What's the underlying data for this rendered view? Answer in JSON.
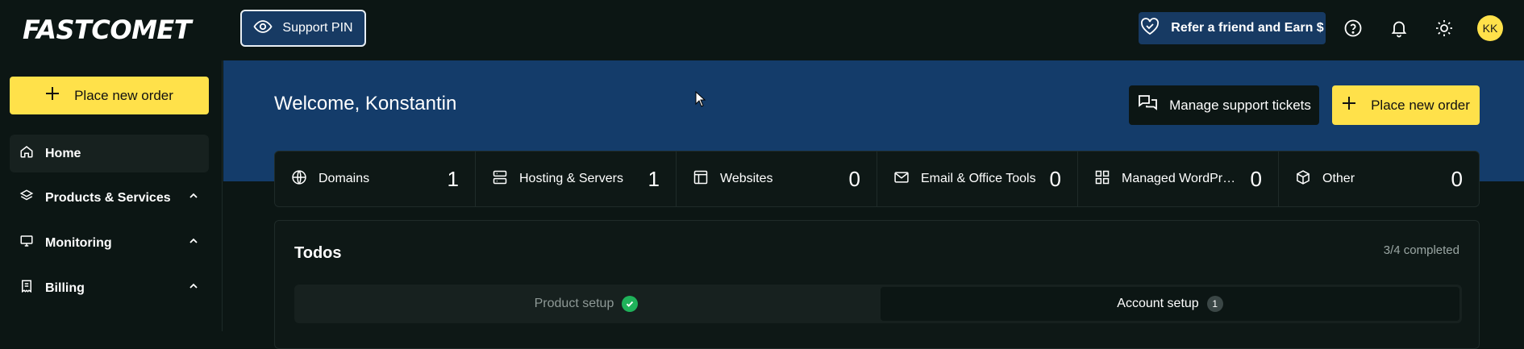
{
  "header": {
    "logo": "FASTCOMET",
    "support_pin_label": "Support PIN",
    "refer_label": "Refer a friend and Earn $",
    "help_icon": "help-circle-icon",
    "notifications_icon": "bell-icon",
    "theme_icon": "sun-icon",
    "avatar_initials": "KK"
  },
  "sidebar": {
    "place_order_label": "Place new order",
    "items": [
      {
        "label": "Home",
        "icon": "home-icon",
        "active": true
      },
      {
        "label": "Products & Services",
        "icon": "layers-icon",
        "expandable": true
      },
      {
        "label": "Monitoring",
        "icon": "monitor-icon",
        "expandable": true
      },
      {
        "label": "Billing",
        "icon": "receipt-icon",
        "expandable": true
      }
    ]
  },
  "main": {
    "welcome": "Welcome, Konstantin",
    "manage_tickets_label": "Manage support tickets",
    "place_order_label": "Place new order",
    "stats": [
      {
        "label": "Domains",
        "count": "1",
        "icon": "globe-icon"
      },
      {
        "label": "Hosting & Servers",
        "count": "1",
        "icon": "server-icon"
      },
      {
        "label": "Websites",
        "count": "0",
        "icon": "layout-icon"
      },
      {
        "label": "Email & Office Tools",
        "count": "0",
        "icon": "mail-icon"
      },
      {
        "label": "Managed WordPr…",
        "count": "0",
        "icon": "grid-icon"
      },
      {
        "label": "Other",
        "count": "0",
        "icon": "box-icon"
      }
    ],
    "todos": {
      "title": "Todos",
      "progress": "3/4 completed",
      "tabs": [
        {
          "label": "Product setup",
          "status": "complete"
        },
        {
          "label": "Account setup",
          "badge": "1",
          "selected": true
        }
      ]
    }
  },
  "colors": {
    "background": "#0c1614",
    "banner": "#143c6a",
    "accent_yellow": "#ffe14a",
    "success_green": "#1fb25a"
  }
}
